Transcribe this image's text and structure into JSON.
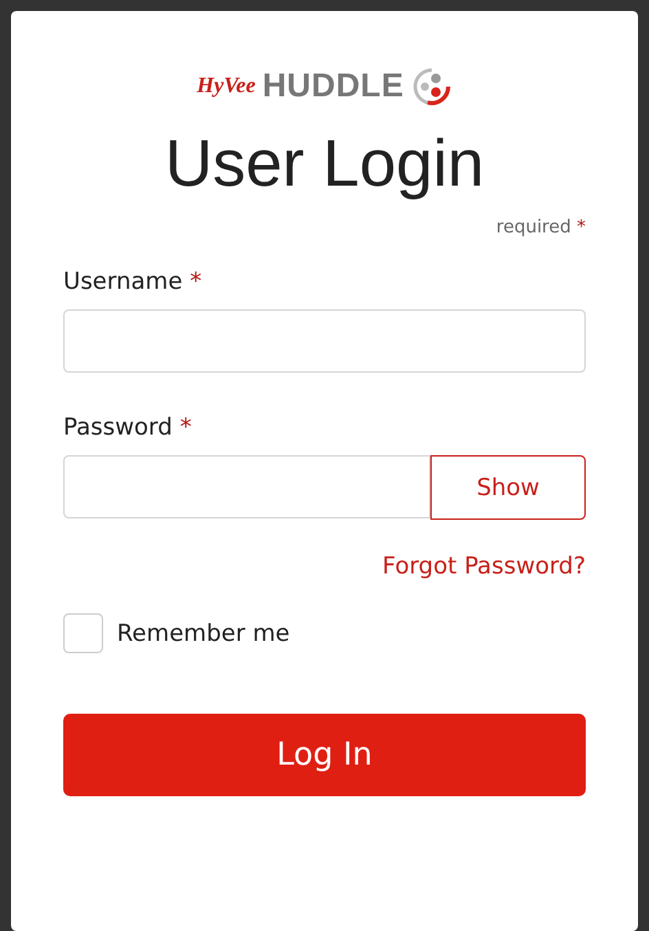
{
  "logo": {
    "brand": "HyVee",
    "product": "HUDDLE"
  },
  "title": "User Login",
  "required_note": {
    "text": "required",
    "mark": "*"
  },
  "username": {
    "label": "Username",
    "mark": "*"
  },
  "password": {
    "label": "Password",
    "mark": "*",
    "show_button": "Show"
  },
  "forgot_link": "Forgot Password?",
  "remember": {
    "label": "Remember me",
    "checked": false
  },
  "submit": "Log In"
}
